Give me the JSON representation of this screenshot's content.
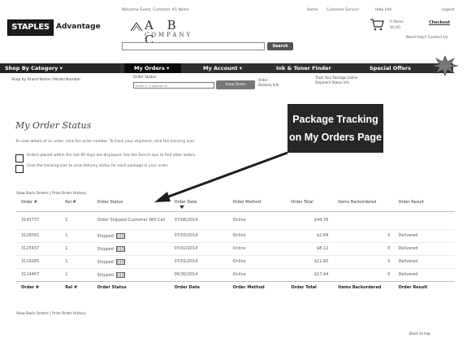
{
  "header": {
    "brand": "STAPLES",
    "brand_suffix": "Advantage",
    "top_text": "Welcome Guest, Customer #1 Name",
    "top_links": [
      "Home",
      "Customer Service",
      "Help Info",
      "Logout"
    ],
    "company_letters": "A B C",
    "company_word": "COMPANY",
    "search_placeholder": "",
    "search_button": "Search",
    "cart_items": "0 Items",
    "cart_total": "$0.00",
    "checkout_label": "Checkout",
    "cart_note": "Need help? Contact Us"
  },
  "nav": {
    "shop_by_category": "Shop By Category ▾",
    "items": [
      "My Orders ▾",
      "My Account ▾",
      "Ink & Toner Finder",
      "Special Offers"
    ],
    "shop_link": "Shop by Brand Name / Model Number"
  },
  "lookup": {
    "label": "Order Status",
    "input_placeholder": "Order # / Customer ID",
    "button": "View Order",
    "check_lines": [
      "Order",
      "Delivery Info"
    ],
    "right_lines": [
      "Track Your Package Online",
      "Shipment Status Info"
    ]
  },
  "page": {
    "title": "My Order Status",
    "intro": "To view details of an order, click the order number. To track your shipment, click the tracking icon.",
    "notes": [
      "Orders placed within the last 90 days are displayed. Use the Search box to find older orders.",
      "Click the tracking icon to view delivery status for each package in your order."
    ],
    "view_link_top": "View Back Orders | Print Order History",
    "view_link_bottom": "View Back Orders | Print Order History",
    "footer_link": "Back to top"
  },
  "callout": {
    "line1": "Package Tracking",
    "line2": "on My Orders Page"
  },
  "orders": {
    "columns": [
      "Order #",
      "Rel #",
      "Order Status",
      "Order Date",
      "Order Method",
      "Order Total",
      "Items Backordered",
      "Order Result"
    ],
    "rows": [
      {
        "order": "3143737",
        "rel": "1",
        "status": "Order Shipped Customer Will Call",
        "track": false,
        "date": "07/08/2014",
        "method": "Online",
        "total": "$44.78",
        "backordered": "",
        "result": ""
      },
      {
        "order": "3128091",
        "rel": "1",
        "status": "Shipped",
        "track": true,
        "date": "07/03/2014",
        "method": "Online",
        "total": "$2.84",
        "backordered": "0",
        "result": "Delivered"
      },
      {
        "order": "3125437",
        "rel": "1",
        "status": "Shipped",
        "track": true,
        "date": "07/02/2014",
        "method": "Online",
        "total": "$8.12",
        "backordered": "0",
        "result": "Delivered"
      },
      {
        "order": "3119285",
        "rel": "1",
        "status": "Shipped",
        "track": true,
        "date": "07/01/2014",
        "method": "Online",
        "total": "$11.60",
        "backordered": "0",
        "result": "Delivered"
      },
      {
        "order": "3114467",
        "rel": "1",
        "status": "Shipped",
        "track": true,
        "date": "06/30/2014",
        "method": "Online",
        "total": "$17.44",
        "backordered": "0",
        "result": "Delivered"
      }
    ],
    "footer": {
      "order": "Order #",
      "rel": "Rel #",
      "status": "Order Status",
      "date": "Order Date",
      "method": "Order Method",
      "total": "Order Total",
      "backordered": "Items Backordered",
      "result": "Order Result"
    }
  }
}
